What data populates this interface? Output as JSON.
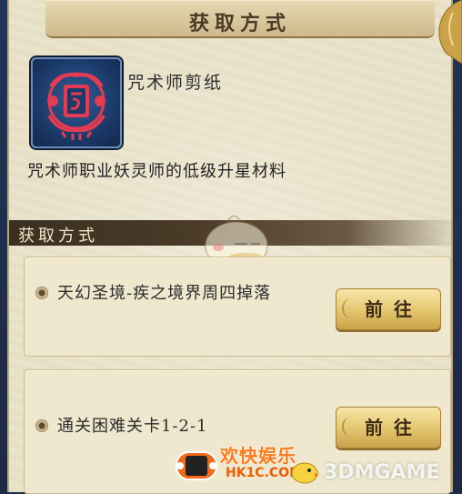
{
  "header": {
    "title": "获取方式"
  },
  "item": {
    "name": "咒术师剪纸",
    "description": "咒术师职业妖灵师的低级升星材料",
    "icon": "paper-cut-talisman-icon"
  },
  "section": {
    "title": "获取方式"
  },
  "sources": [
    {
      "text": "天幻圣境-疾之境界周四掉落",
      "button_label": "前往"
    },
    {
      "text": "通关困难关卡1-2-1",
      "button_label": "前往"
    }
  ],
  "watermark": {
    "brand_cn": "欢快娱乐",
    "site": "HK1C.COM",
    "brand_en": "3DMGAME"
  },
  "colors": {
    "parchment": "#e9e2c9",
    "frame": "#1f2f4a",
    "button_gold": "#e3c56d",
    "section_bar": "#3b2f20"
  }
}
